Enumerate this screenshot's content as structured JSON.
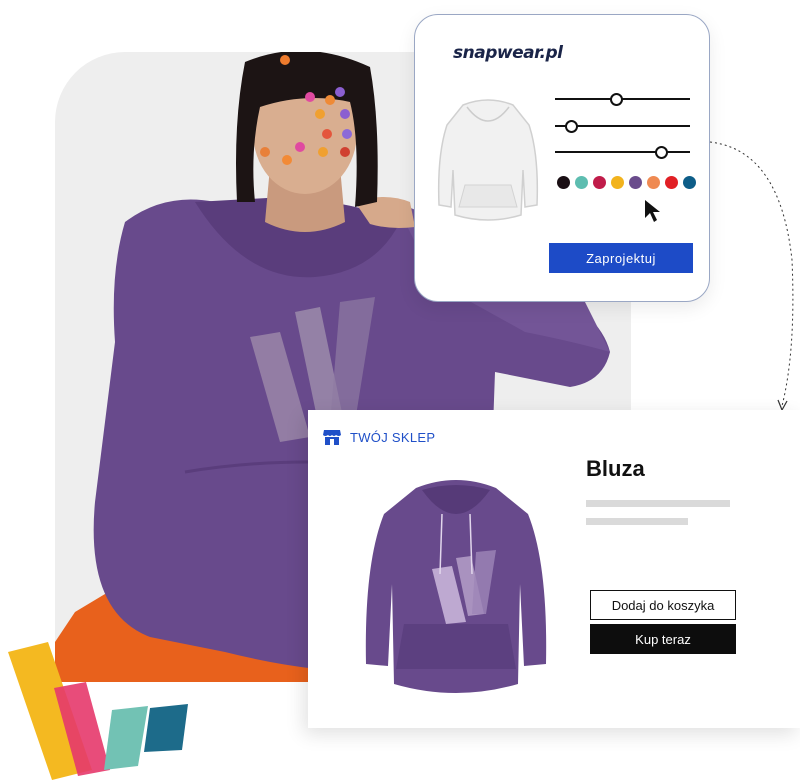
{
  "configurator": {
    "logo_prefix": "snap",
    "logo_w": "w",
    "logo_suffix": "ear.pl",
    "sliders": [
      0.45,
      0.08,
      0.82
    ],
    "colors": [
      "#1a0f14",
      "#5dbdb0",
      "#c01c4a",
      "#f2b31d",
      "#6a4c8c",
      "#ef8a52",
      "#e11f25",
      "#0d5d88"
    ],
    "design_button": "Zaprojektuj",
    "icons": [
      "hoodie-icon",
      "cursor-icon"
    ]
  },
  "shop": {
    "store_name": "TWÓJ SKLEP",
    "store_icon": "store-icon",
    "product_title": "Bluza",
    "add_to_cart": "Dodaj do koszyka",
    "buy_now": "Kup teraz"
  },
  "colors": {
    "accent": "#1d4bc7",
    "hoodie": "#684a8c",
    "pants": "#e8611c"
  }
}
